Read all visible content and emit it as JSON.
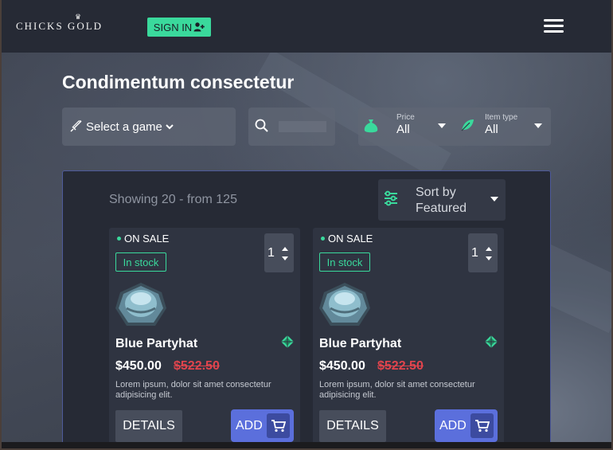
{
  "header": {
    "logo_text": "CHICKS GOLD",
    "signin_label": "SIGN IN",
    "signin_icon": "user-plus-icon",
    "menu_icon": "hamburger-icon"
  },
  "main": {
    "title": "Condimentum consectetur"
  },
  "filters": {
    "game_select_label": "Select a game",
    "search_value": "",
    "price_label": "Price",
    "price_value": "All",
    "itemtype_label": "Item type",
    "itemtype_value": "All"
  },
  "listing": {
    "showing_text": "Showing 20 - from 125",
    "sort_line1": "Sort by",
    "sort_line2": "Featured"
  },
  "products": [
    {
      "badge": "ON SALE",
      "stock": "In stock",
      "qty": "1",
      "name": "Blue Partyhat",
      "price": "$450.00",
      "old_price": "$522.50",
      "desc": "Lorem ipsum, dolor sit amet consectetur adipisicing elit.",
      "details_label": "DETAILS",
      "add_label": "ADD"
    },
    {
      "badge": "ON SALE",
      "stock": "In stock",
      "qty": "1",
      "name": "Blue Partyhat",
      "price": "$450.00",
      "old_price": "$522.50",
      "desc": "Lorem ipsum, dolor sit amet consectetur adipisicing elit.",
      "details_label": "DETAILS",
      "add_label": "ADD"
    }
  ],
  "colors": {
    "accent_green": "#3ad99c",
    "add_blue": "#5b6fdc",
    "old_price_red": "#e0444d",
    "header_bg": "#262a35"
  }
}
